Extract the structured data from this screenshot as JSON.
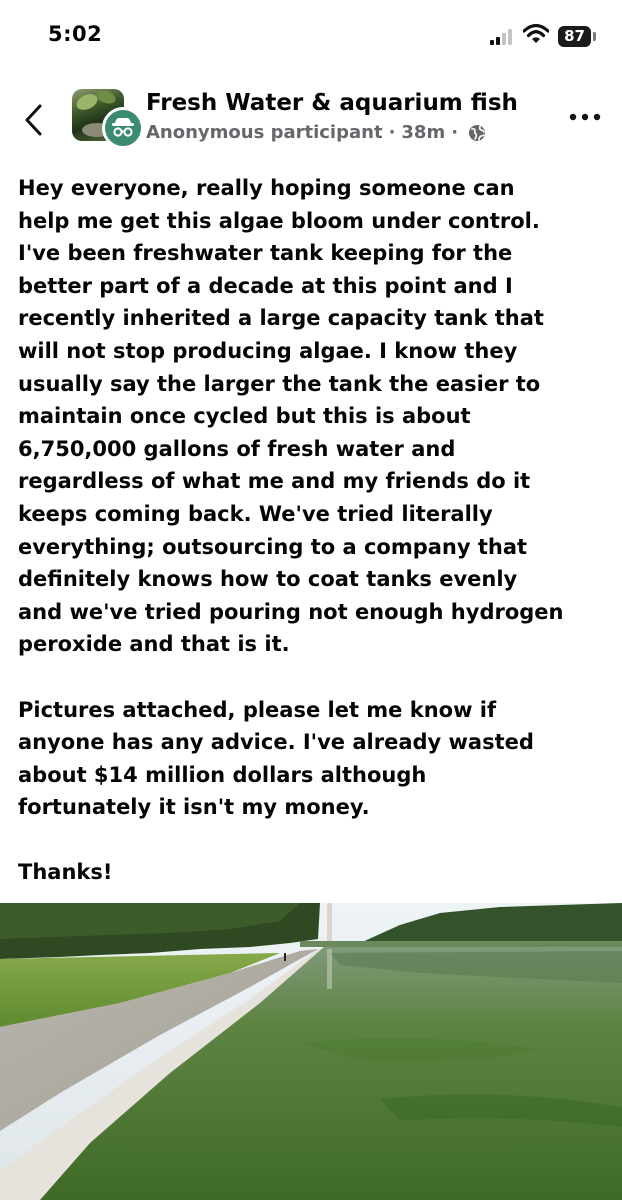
{
  "status": {
    "time": "5:02",
    "battery": "87",
    "icons": [
      "signal-icon",
      "wifi-icon",
      "battery-icon"
    ]
  },
  "header": {
    "group_name": "Fresh Water & aquarium fish",
    "author": "Anonymous participant",
    "separator": "·",
    "timestamp": "38m",
    "icons": [
      "back-chevron-icon",
      "globe-icon",
      "more-options-icon",
      "incognito-icon"
    ]
  },
  "post": {
    "paragraph_1": "Hey everyone, really hoping someone can\nhelp me get this algae bloom under control.\nI've been freshwater tank keeping for the\nbetter part of a decade at this point and I\nrecently inherited a large capacity tank that\nwill not stop producing algae. I know they\nusually say the larger the tank the easier to\nmaintain once cycled but this is about\n6,750,000 gallons of fresh water and\nregardless of what me and my friends do it\nkeeps coming back. We've tried literally\neverything; outsourcing to a company that\ndefinitely knows how to coat tanks evenly\nand we've tried pouring not enough hydrogen\nperoxide and that is it.",
    "paragraph_2": "Pictures attached, please let me know if\nanyone has any advice. I've already wasted\nabout $14 million dollars although\nfortunately it isn't my money.",
    "paragraph_3": "Thanks!"
  },
  "colors": {
    "text": "#050505",
    "meta": "#65676b",
    "water": "#4f7a35",
    "grass": "#6f9a3a",
    "badge": "#3c8a6f"
  }
}
